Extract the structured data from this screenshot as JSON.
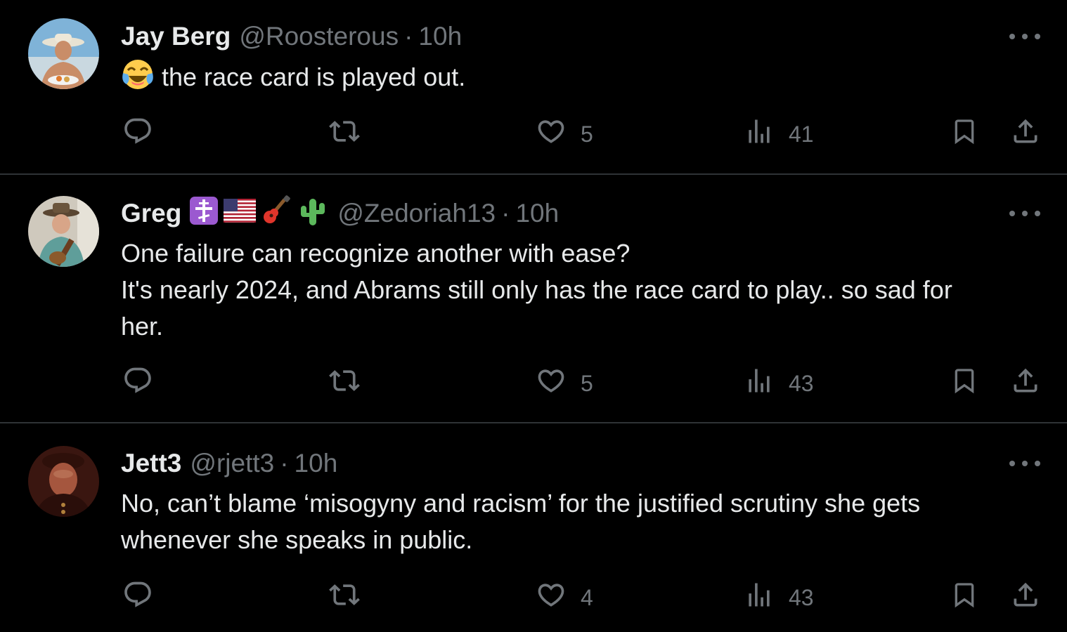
{
  "tweets": [
    {
      "name": "Jay Berg",
      "handle": "@Roosterous",
      "separator": "·",
      "time": "10h",
      "emoji_icon": "tears-of-joy-emoji",
      "text_lines": [
        "the race card is played out."
      ],
      "reply_count": "",
      "retweet_count": "",
      "like_count": "5",
      "view_count": "41"
    },
    {
      "name": "Greg",
      "badge_icons": [
        "orthodox-cross-emoji",
        "us-flag-emoji",
        "guitar-emoji",
        "cactus-emoji"
      ],
      "handle": "@Zedoriah13",
      "separator": "·",
      "time": "10h",
      "text_lines": [
        "One failure can recognize another with ease?",
        "It's nearly 2024, and Abrams still only has the race card to play.. so sad for",
        "her."
      ],
      "reply_count": "",
      "retweet_count": "",
      "like_count": "5",
      "view_count": "43"
    },
    {
      "name": "Jett3",
      "handle": "@rjett3",
      "separator": "·",
      "time": "10h",
      "text_lines": [
        "No, can’t blame ‘misogyny and racism’ for the justified scrutiny she gets",
        "whenever she speaks in public."
      ],
      "reply_count": "",
      "retweet_count": "",
      "like_count": "4",
      "view_count": "43"
    }
  ],
  "colors": {
    "background": "#000000",
    "primary_text": "#e7e9ea",
    "secondary_text": "#71767b",
    "divider": "#2f3336"
  }
}
